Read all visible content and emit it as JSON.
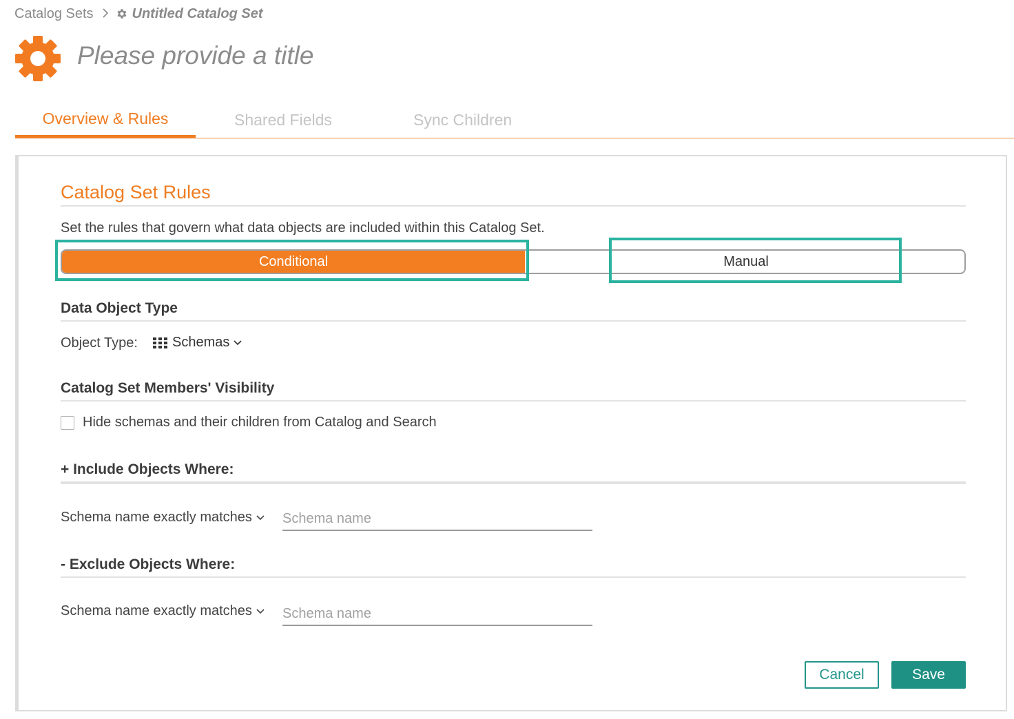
{
  "breadcrumb": {
    "parent": "Catalog Sets",
    "separator": ">",
    "current": "Untitled Catalog Set",
    "current_icon": "gear-icon"
  },
  "header": {
    "icon": "gear-icon",
    "title_placeholder": "Please provide a title"
  },
  "tabs": [
    {
      "label": "Overview & Rules",
      "active": true
    },
    {
      "label": "Shared Fields",
      "active": false
    },
    {
      "label": "Sync Children",
      "active": false
    }
  ],
  "rules": {
    "title": "Catalog Set Rules",
    "description": "Set the rules that govern what data objects are included within this Catalog Set.",
    "modes": [
      {
        "label": "Conditional",
        "selected": true
      },
      {
        "label": "Manual",
        "selected": false
      }
    ]
  },
  "data_object_type": {
    "title": "Data Object Type",
    "label": "Object Type:",
    "value": "Schemas",
    "icon": "grid-icon"
  },
  "visibility": {
    "title": "Catalog Set Members' Visibility",
    "checkbox_label": "Hide schemas and their children from Catalog and Search",
    "checked": false
  },
  "include": {
    "title": "+ Include Objects Where:",
    "condition": "Schema name exactly matches",
    "value": "",
    "placeholder": "Schema name"
  },
  "exclude": {
    "title": "- Exclude Objects Where:",
    "condition": "Schema name exactly matches",
    "value": "",
    "placeholder": "Schema name"
  },
  "actions": {
    "cancel": "Cancel",
    "save": "Save"
  },
  "colors": {
    "accent": "#ef7d22",
    "teal": "#1f9184",
    "highlight": "#2bb3a0"
  }
}
